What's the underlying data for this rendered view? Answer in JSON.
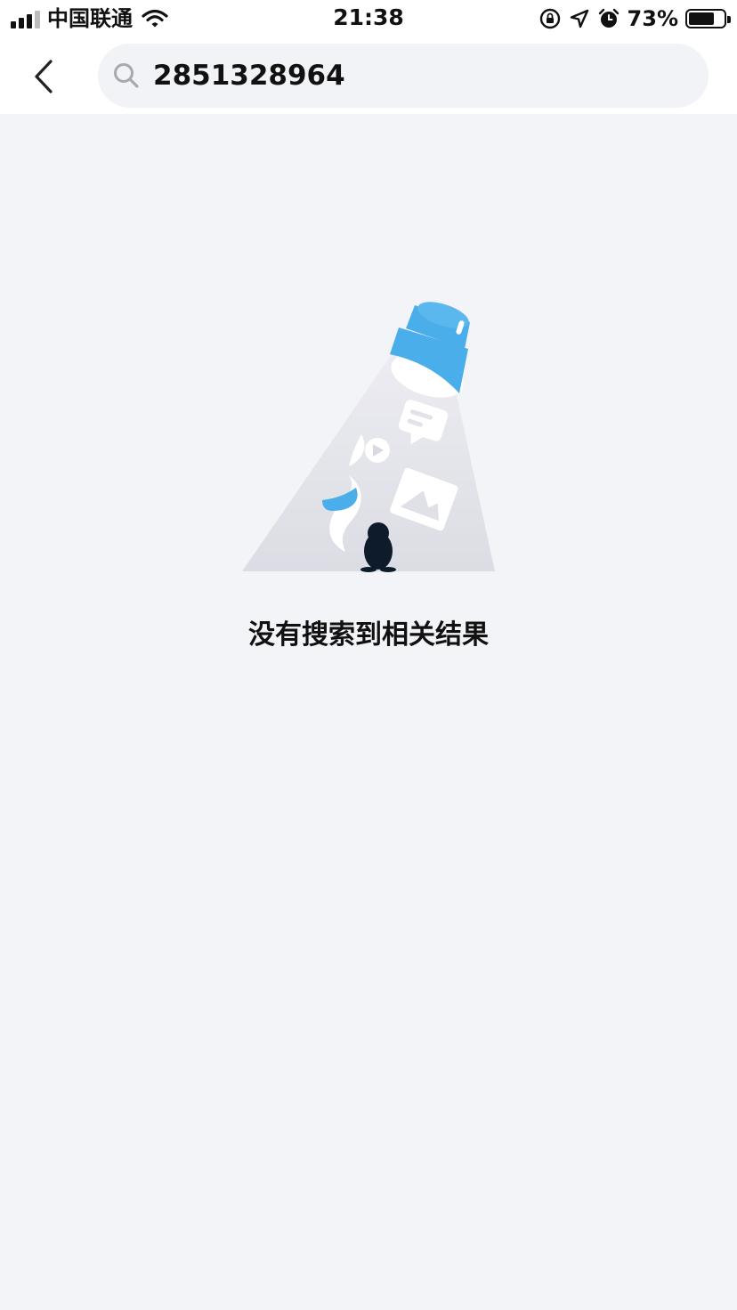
{
  "status_bar": {
    "carrier": "中国联通",
    "time": "21:38",
    "battery_percent": "73%",
    "battery_level": 0.73,
    "icons": [
      "signal-icon",
      "wifi-icon",
      "orientation-lock-icon",
      "location-icon",
      "alarm-icon",
      "battery-icon"
    ]
  },
  "nav": {
    "back_icon": "chevron-left-icon",
    "search_icon": "search-icon",
    "search_value": "2851328964"
  },
  "empty_state": {
    "illustration": "flashlight-empty-search-illustration",
    "message": "没有搜索到相关结果"
  },
  "colors": {
    "accent": "#4aaeea",
    "background": "#f3f4f8",
    "search_bg": "#f2f3f7"
  }
}
